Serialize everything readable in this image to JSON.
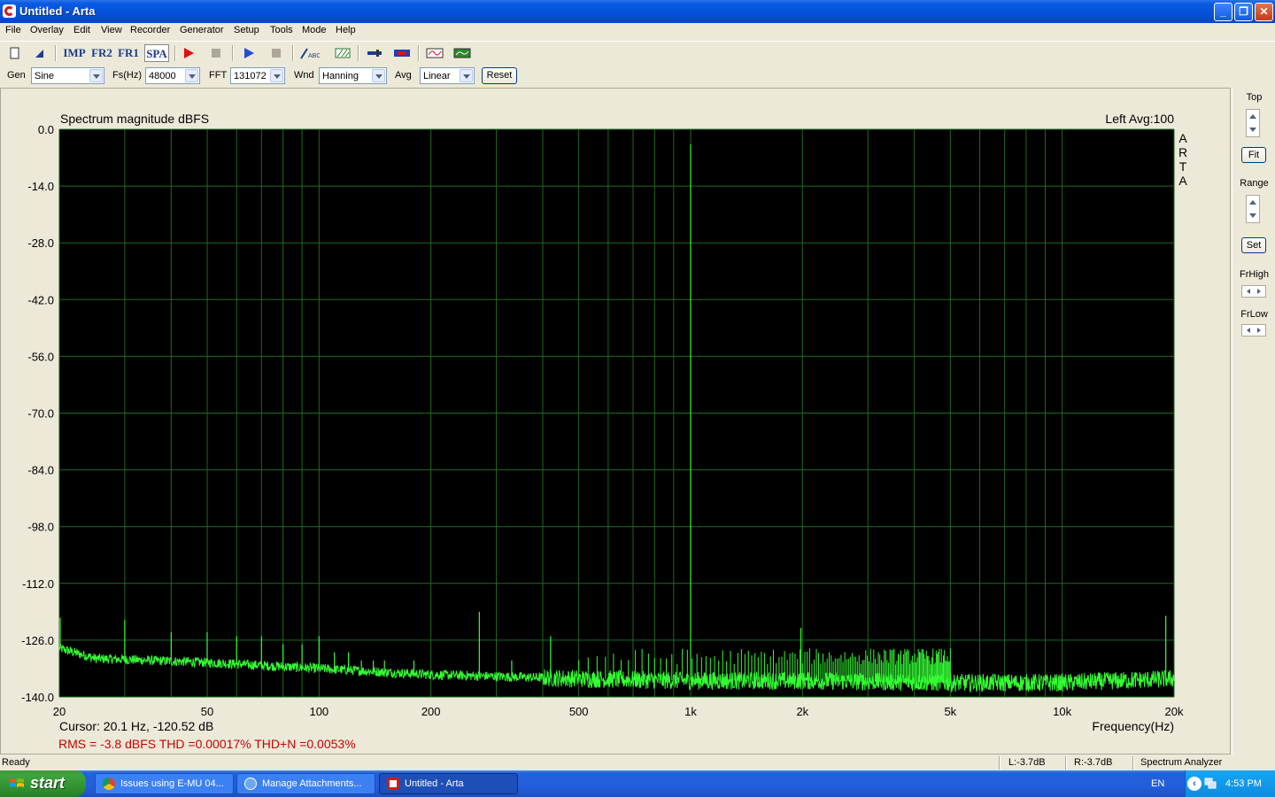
{
  "window": {
    "title": "Untitled - Arta"
  },
  "menu": [
    "File",
    "Overlay",
    "Edit",
    "View",
    "Recorder",
    "Generator",
    "Setup",
    "Tools",
    "Mode",
    "Help"
  ],
  "toolbar": {
    "imp": "IMP",
    "fr2": "FR2",
    "fr1": "FR1",
    "spa": "SPA"
  },
  "controls": {
    "gen_label": "Gen",
    "gen_value": "Sine",
    "fs_label": "Fs(Hz)",
    "fs_value": "48000",
    "fft_label": "FFT",
    "fft_value": "131072",
    "wnd_label": "Wnd",
    "wnd_value": "Hanning",
    "avg_label": "Avg",
    "avg_value": "Linear",
    "reset": "Reset"
  },
  "right_panel": {
    "top": "Top",
    "fit": "Fit",
    "range": "Range",
    "set": "Set",
    "frhigh": "FrHigh",
    "frlow": "FrLow"
  },
  "plot": {
    "title": "Spectrum magnitude dBFS",
    "channel_info": "Left  Avg:100",
    "side_letters": [
      "A",
      "R",
      "T",
      "A"
    ],
    "cursor": "Cursor:    20.1 Hz, -120.52 dB",
    "measurements": "RMS =   -3.8 dBFS    THD =0.00017%    THD+N =0.0053%",
    "xlabel": "Frequency(Hz)"
  },
  "chart_data": {
    "type": "line",
    "title": "Spectrum magnitude dBFS",
    "xlabel": "Frequency(Hz)",
    "ylabel": "",
    "xscale": "log",
    "xlim": [
      20,
      20000
    ],
    "ylim": [
      -140,
      0
    ],
    "y_ticks": [
      "0.0",
      "-14.0",
      "-28.0",
      "-42.0",
      "-56.0",
      "-70.0",
      "-84.0",
      "-98.0",
      "-112.0",
      "-126.0",
      "-140.0"
    ],
    "x_ticks": [
      {
        "v": 20,
        "label": "20"
      },
      {
        "v": 50,
        "label": "50"
      },
      {
        "v": 100,
        "label": "100"
      },
      {
        "v": 200,
        "label": "200"
      },
      {
        "v": 500,
        "label": "500"
      },
      {
        "v": 1000,
        "label": "1k"
      },
      {
        "v": 2000,
        "label": "2k"
      },
      {
        "v": 5000,
        "label": "5k"
      },
      {
        "v": 10000,
        "label": "10k"
      },
      {
        "v": 20000,
        "label": "20k"
      }
    ],
    "grid": true,
    "background": "#000000",
    "trace_color": "#33ff33",
    "grid_color": "#1e6b1e",
    "fundamental": {
      "freq": 1000,
      "level": -3.7
    },
    "noise_floor": [
      {
        "f": 20,
        "db": -128
      },
      {
        "f": 25,
        "db": -130.5
      },
      {
        "f": 50,
        "db": -131.5
      },
      {
        "f": 100,
        "db": -133
      },
      {
        "f": 200,
        "db": -134.5
      },
      {
        "f": 500,
        "db": -135.5
      },
      {
        "f": 1000,
        "db": -136
      },
      {
        "f": 2000,
        "db": -136
      },
      {
        "f": 5000,
        "db": -136.5
      },
      {
        "f": 10000,
        "db": -136.5
      },
      {
        "f": 20000,
        "db": -135.5
      }
    ],
    "spikes": [
      {
        "f": 20.1,
        "db": -120.5
      },
      {
        "f": 30,
        "db": -121
      },
      {
        "f": 40,
        "db": -124
      },
      {
        "f": 50,
        "db": -124
      },
      {
        "f": 60,
        "db": -125
      },
      {
        "f": 70,
        "db": -125
      },
      {
        "f": 80,
        "db": -127
      },
      {
        "f": 90,
        "db": -127
      },
      {
        "f": 100,
        "db": -125
      },
      {
        "f": 110,
        "db": -129
      },
      {
        "f": 120,
        "db": -129
      },
      {
        "f": 130,
        "db": -131
      },
      {
        "f": 140,
        "db": -131
      },
      {
        "f": 150,
        "db": -131
      },
      {
        "f": 180,
        "db": -131
      },
      {
        "f": 270,
        "db": -119
      },
      {
        "f": 330,
        "db": -131
      },
      {
        "f": 420,
        "db": -125
      },
      {
        "f": 1980,
        "db": -123
      },
      {
        "f": 19000,
        "db": -120
      }
    ],
    "harmonic_comb": {
      "start": 500,
      "end": 5000,
      "step": 30,
      "db": -130
    }
  },
  "status": {
    "ready": "Ready",
    "left": "L:-3.7dB",
    "right": "R:-3.7dB",
    "mode": "Spectrum Analyzer"
  },
  "taskbar": {
    "start": "start",
    "tasks": [
      "Issues using E-MU 04...",
      "Manage Attachments...",
      "Untitled - Arta"
    ],
    "lang": "EN",
    "clock": "4:53 PM"
  },
  "colors": {
    "title_bar": "#0550d8",
    "measure_red": "#cc0000",
    "taskbar": "#245edb",
    "start_green": "#3ea53e"
  }
}
